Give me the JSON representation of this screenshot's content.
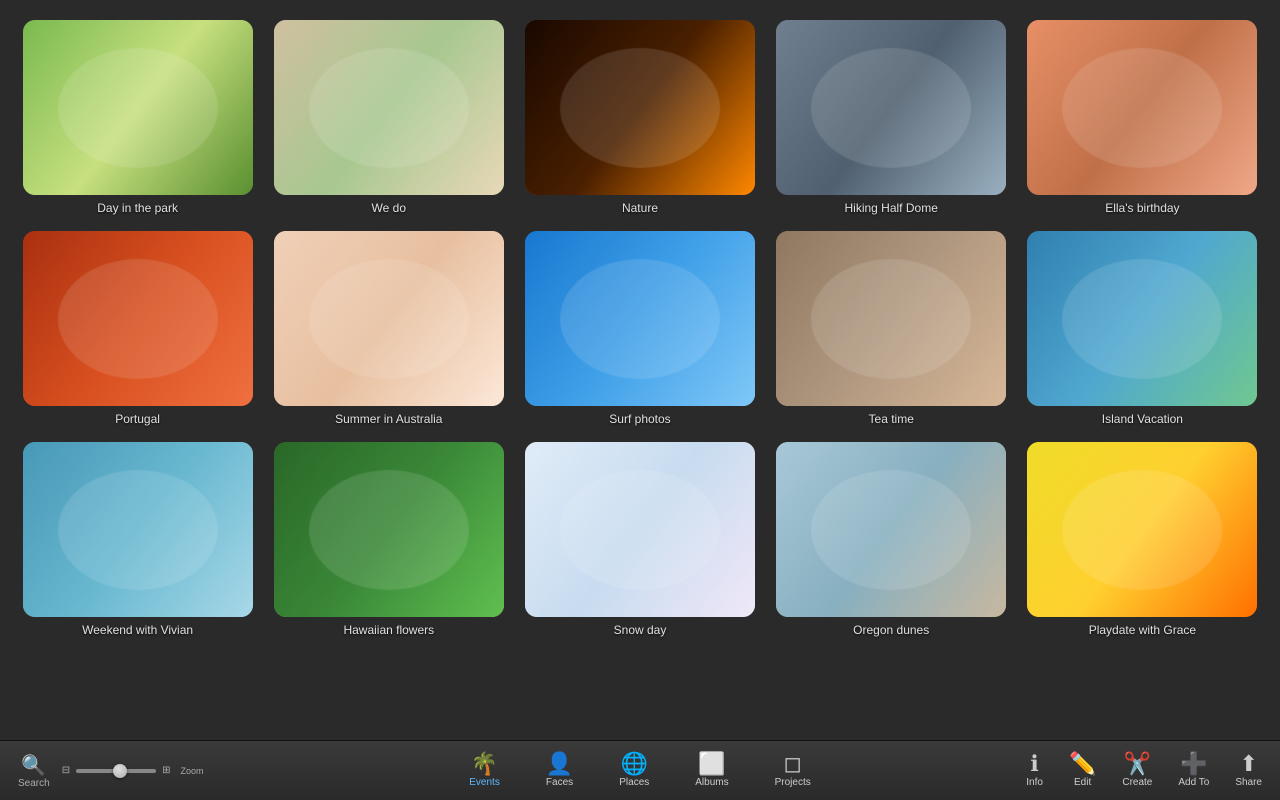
{
  "photos": [
    {
      "id": 1,
      "label": "Day in the park",
      "thumb_class": "thumb-1"
    },
    {
      "id": 2,
      "label": "We do",
      "thumb_class": "thumb-2"
    },
    {
      "id": 3,
      "label": "Nature",
      "thumb_class": "thumb-3"
    },
    {
      "id": 4,
      "label": "Hiking Half Dome",
      "thumb_class": "thumb-4"
    },
    {
      "id": 5,
      "label": "Ella's birthday",
      "thumb_class": "thumb-5"
    },
    {
      "id": 6,
      "label": "Portugal",
      "thumb_class": "thumb-6"
    },
    {
      "id": 7,
      "label": "Summer in Australia",
      "thumb_class": "thumb-7"
    },
    {
      "id": 8,
      "label": "Surf photos",
      "thumb_class": "thumb-8"
    },
    {
      "id": 9,
      "label": "Tea time",
      "thumb_class": "thumb-9"
    },
    {
      "id": 10,
      "label": "Island Vacation",
      "thumb_class": "thumb-10"
    },
    {
      "id": 11,
      "label": "Weekend with Vivian",
      "thumb_class": "thumb-11"
    },
    {
      "id": 12,
      "label": "Hawaiian flowers",
      "thumb_class": "thumb-12"
    },
    {
      "id": 13,
      "label": "Snow day",
      "thumb_class": "thumb-13"
    },
    {
      "id": 14,
      "label": "Oregon dunes",
      "thumb_class": "thumb-14"
    },
    {
      "id": 15,
      "label": "Playdate with Grace",
      "thumb_class": "thumb-15"
    }
  ],
  "toolbar": {
    "search_label": "Search",
    "zoom_label": "Zoom",
    "events_label": "Events",
    "faces_label": "Faces",
    "places_label": "Places",
    "albums_label": "Albums",
    "projects_label": "Projects",
    "info_label": "Info",
    "edit_label": "Edit",
    "create_label": "Create",
    "add_to_label": "Add To",
    "share_label": "Share"
  }
}
